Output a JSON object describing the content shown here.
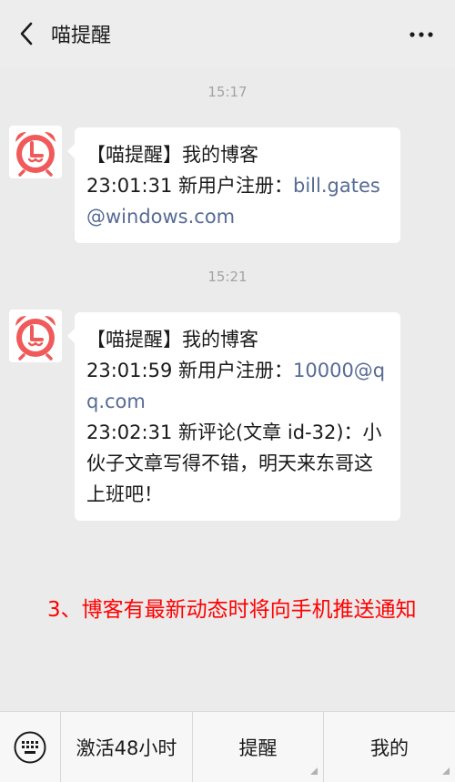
{
  "header": {
    "title": "喵提醒"
  },
  "messages": [
    {
      "time": "15:17",
      "line1": "【喵提醒】我的博客",
      "line2_prefix": "23:01:31 新用户注册：",
      "line2_link": "bill.gates@windows.com"
    },
    {
      "time": "15:21",
      "line1": "【喵提醒】我的博客",
      "line2_prefix": "23:01:59 新用户注册：",
      "line2_link": "10000@qq.com",
      "line3": "23:02:31 新评论(文章 id-32)：小伙子文章写得不错，明天来东哥这上班吧！"
    }
  ],
  "note": "3、博客有最新动态时将向手机推送通知",
  "bottom_menu": {
    "items": [
      "激活48小时",
      "提醒",
      "我的"
    ]
  },
  "colors": {
    "link": "#576b95",
    "note": "#ff0000",
    "avatar_red": "#f05a5a"
  },
  "icons": {
    "back": "chevron-left-icon",
    "more": "more-dots-icon",
    "avatar": "alarm-clock-icon",
    "keyboard": "keyboard-icon"
  }
}
